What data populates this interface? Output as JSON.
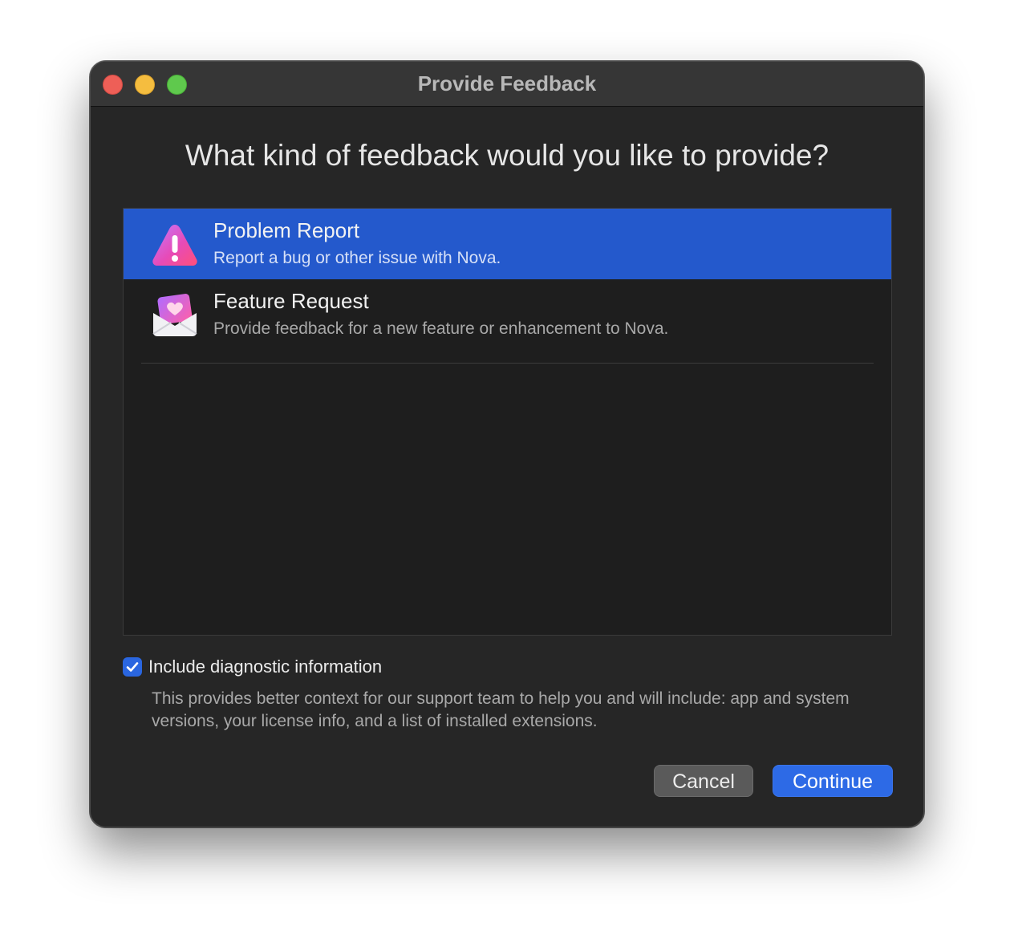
{
  "window": {
    "title": "Provide Feedback"
  },
  "heading": "What kind of feedback would you like to provide?",
  "options": [
    {
      "title": "Problem Report",
      "subtitle": "Report a bug or other issue with Nova.",
      "icon": "warning-triangle-icon",
      "selected": true
    },
    {
      "title": "Feature Request",
      "subtitle": "Provide feedback for a new feature or enhancement to Nova.",
      "icon": "heart-envelope-icon",
      "selected": false
    }
  ],
  "diagnostic": {
    "label": "Include diagnostic information",
    "checked": true,
    "description": "This provides better context for our support team to help you and will include: app and system versions, your license info, and a list of installed extensions."
  },
  "buttons": {
    "cancel": "Cancel",
    "continue": "Continue"
  },
  "colors": {
    "selection": "#2459cc",
    "accent": "#2d6ae6",
    "close": "#ee5f57",
    "minimize": "#f5bd3f",
    "maximize": "#5fc94d"
  }
}
